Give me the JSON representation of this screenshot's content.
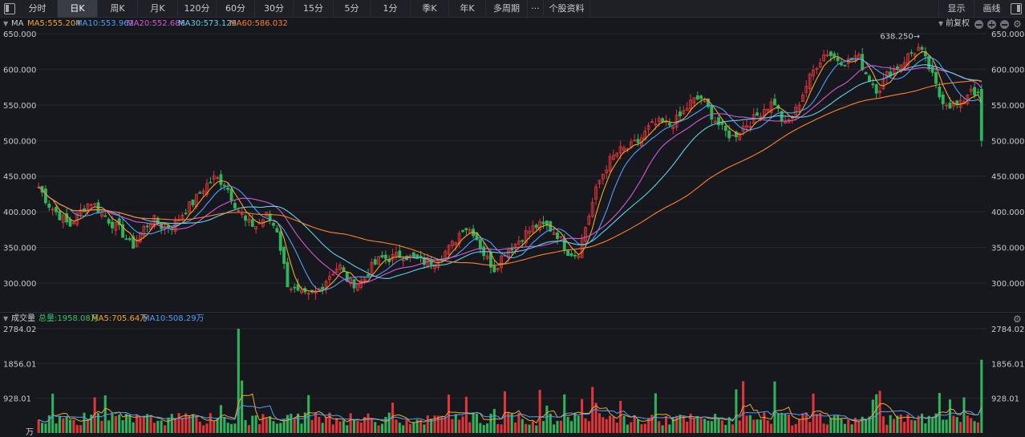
{
  "toolbar": {
    "periods": [
      "分时",
      "日K",
      "周K",
      "月K",
      "120分",
      "60分",
      "30分",
      "15分",
      "5分",
      "1分",
      "季K",
      "年K",
      "多周期",
      "···",
      "个股资料"
    ],
    "active_period": "日K",
    "display_label": "显示",
    "draw_label": "画线"
  },
  "price_panel": {
    "indicator": "MA",
    "ma": [
      {
        "label": "MA5:555.204",
        "color": "#f5a623"
      },
      {
        "label": "MA10:553.962",
        "color": "#4c9fff"
      },
      {
        "label": "MA20:552.686",
        "color": "#d45ad8"
      },
      {
        "label": "MA30:573.129",
        "color": "#5fd0e8"
      },
      {
        "label": "MA60:586.032",
        "color": "#ff7f2a"
      }
    ],
    "adjust_label": "前复权",
    "high_marker": "638.250→",
    "y_labels": [
      "650.000",
      "600.000",
      "550.000",
      "500.000",
      "450.000",
      "400.000",
      "350.000",
      "300.000"
    ]
  },
  "volume_panel": {
    "title": "成交量",
    "total": "总量:1958.08万",
    "ma5": "MA5:705.64万",
    "ma10": "MA10:508.29万",
    "colors": {
      "total": "#36c06b",
      "ma5": "#f5a623",
      "ma10": "#4c9fff"
    },
    "y_labels": [
      "2784.02",
      "1856.01",
      "928.01"
    ],
    "unit": "万"
  },
  "colors": {
    "up": "#e0363a",
    "down": "#2fb35b",
    "grid": "#26272d",
    "background": "#17181d"
  },
  "chart_data": {
    "type": "candlestick",
    "price_range": [
      260,
      650
    ],
    "price_ticks": [
      650,
      600,
      550,
      500,
      450,
      400,
      350,
      300
    ],
    "series_anchor_closes": [
      435,
      410,
      395,
      380,
      400,
      415,
      400,
      385,
      372,
      350,
      375,
      390,
      378,
      380,
      400,
      415,
      435,
      448,
      440,
      410,
      385,
      380,
      395,
      375,
      300,
      285,
      280,
      290,
      310,
      325,
      300,
      300,
      320,
      335,
      335,
      340,
      335,
      330,
      330,
      340,
      355,
      380,
      372,
      340,
      320,
      345,
      355,
      370,
      380,
      380,
      370,
      345,
      340,
      390,
      440,
      470,
      485,
      490,
      500,
      520,
      525,
      522,
      535,
      555,
      560,
      535,
      515,
      505,
      520,
      530,
      545,
      555,
      520,
      540,
      575,
      605,
      625,
      615,
      610,
      620,
      590,
      570,
      595,
      605,
      620,
      630,
      600,
      560,
      550,
      550,
      575,
      555
    ],
    "last_close": 500,
    "high_marker_value": 638.25,
    "volume_ticks": [
      2784.02,
      1856.01,
      928.01
    ],
    "volume_range": [
      0,
      2784.02
    ]
  }
}
